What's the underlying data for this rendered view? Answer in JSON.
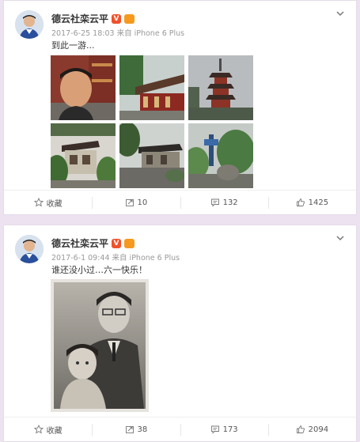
{
  "posts": [
    {
      "author": "德云社栾云平",
      "meta": "2017-6-25 18:03 来自 iPhone 6 Plus",
      "text": "到此一游...",
      "actions": {
        "favorite": "收藏",
        "repost": "10",
        "comment": "132",
        "like": "1425"
      }
    },
    {
      "author": "德云社栾云平",
      "meta": "2017-6-1 09:44 来自 iPhone 6 Plus",
      "text": "谁还没小过…六一快乐！",
      "actions": {
        "favorite": "收藏",
        "repost": "38",
        "comment": "173",
        "like": "2094"
      }
    }
  ],
  "icons": {
    "verified": "verified-v-icon",
    "crown": "member-crown-icon",
    "menu": "chevron-down-icon",
    "favorite": "star-icon",
    "repost": "repost-icon",
    "comment": "comment-icon",
    "like": "thumbs-up-icon"
  },
  "colors": {
    "background": "#ece2f0",
    "verified": "#f0512a",
    "member": "#f59a1e",
    "muted": "#999999"
  }
}
